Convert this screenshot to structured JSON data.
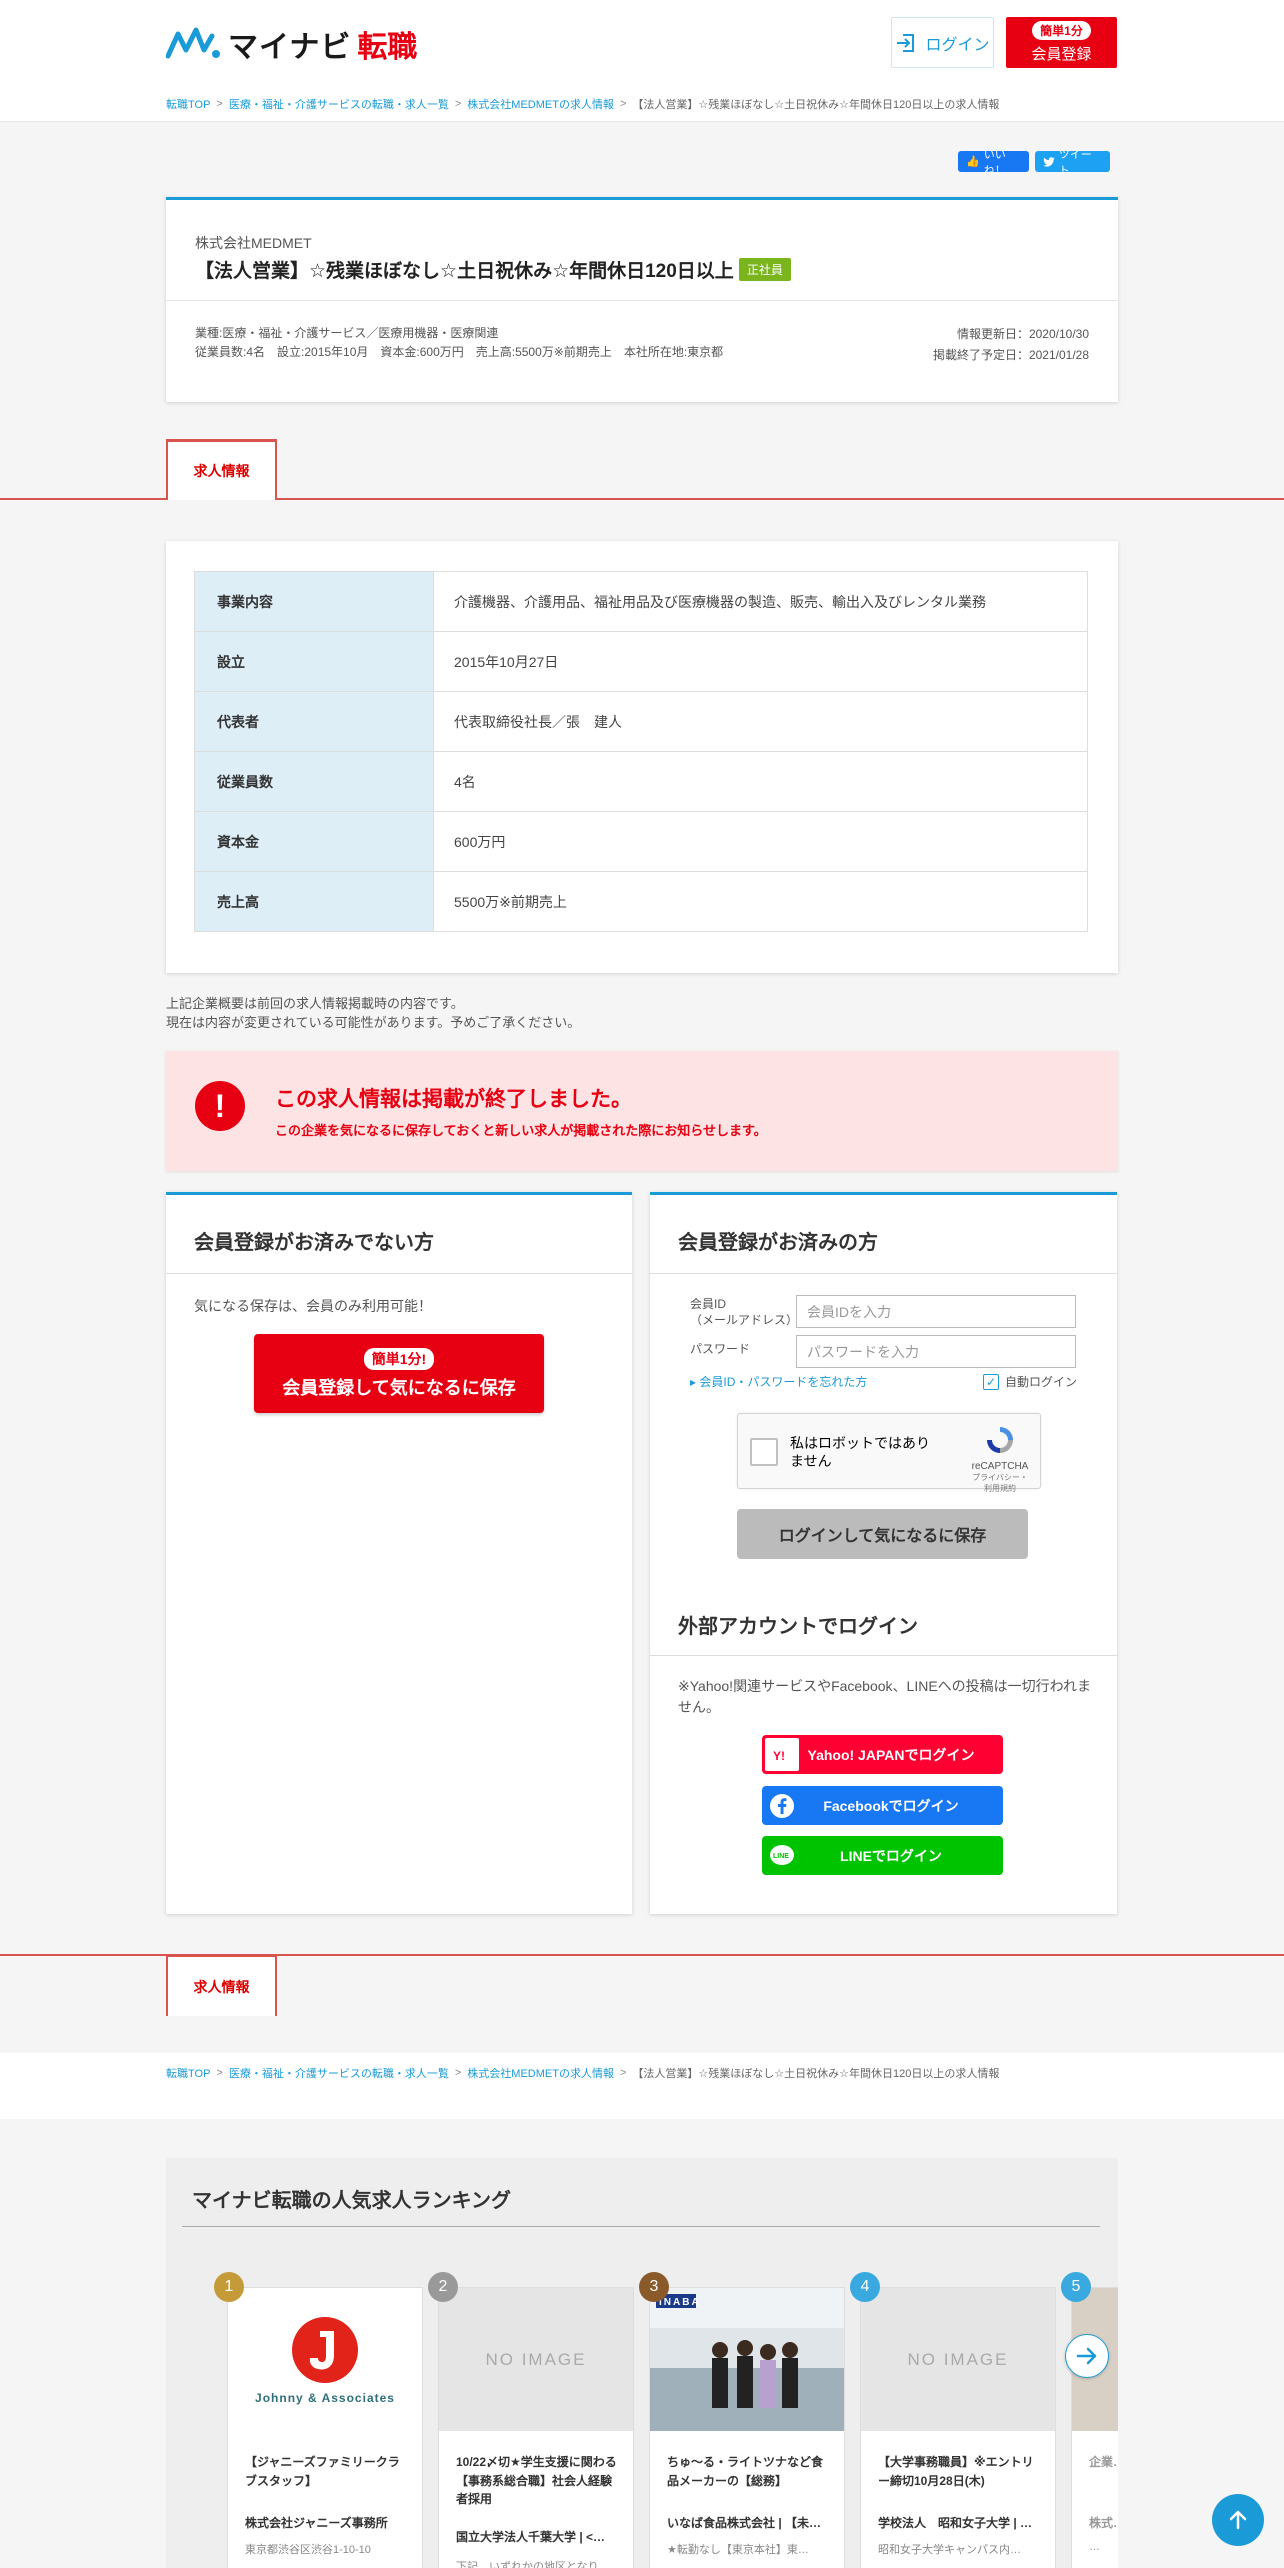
{
  "header": {
    "logo_main": "マイナビ",
    "logo_sub": "転職",
    "login_label": "ログイン",
    "register_pill": "簡単1分",
    "register_label": "会員登録"
  },
  "breadcrumb_top": [
    "転職TOP",
    "医療・福祉・介護サービスの転職・求人一覧",
    "株式会社MEDMETの求人情報",
    "【法人営業】☆残業ほぼなし☆土日祝休み☆年間休日120日以上の求人情報"
  ],
  "breadcrumb_bottom": [
    "転職TOP",
    "医療・福祉・介護サービスの転職・求人一覧",
    "株式会社MEDMETの求人情報",
    "【法人営業】☆残業ほぼなし☆土日祝休み☆年間休日120日以上の求人情報"
  ],
  "social": {
    "like": "いいね！",
    "tweet": "ツイート"
  },
  "job": {
    "company": "株式会社MEDMET",
    "title": "【法人営業】☆残業ほぼなし☆土日祝休み☆年間休日120日以上",
    "employment_type": "正社員",
    "industry": "業種:医療・福祉・介護サービス／医療用機器・医療関連",
    "summary": "従業員数:4名　設立:2015年10月　資本金:600万円　売上高:5500万※前期売上　本社所在地:東京都",
    "updated": "情報更新日：2020/10/30",
    "end_date": "掲載終了予定日：2021/01/28"
  },
  "tabs": {
    "job_info": "求人情報"
  },
  "company_info": [
    {
      "label": "事業内容",
      "value": "介護機器、介護用品、福祉用品及び医療機器の製造、販売、輸出入及びレンタル業務"
    },
    {
      "label": "設立",
      "value": "2015年10月27日"
    },
    {
      "label": "代表者",
      "value": "代表取締役社長／張　建人"
    },
    {
      "label": "従業員数",
      "value": "4名"
    },
    {
      "label": "資本金",
      "value": "600万円"
    },
    {
      "label": "売上高",
      "value": "5500万※前期売上"
    }
  ],
  "notice": {
    "line1": "上記企業概要は前回の求人情報掲載時の内容です。",
    "line2": "現在は内容が変更されている可能性があります。予めご了承ください。"
  },
  "ended": {
    "icon": "!",
    "title": "この求人情報は掲載が終了しました。",
    "subtitle": "この企業を気になるに保存しておくと新しい求人が掲載された際にお知らせします。"
  },
  "non_member": {
    "title": "会員登録がお済みでない方",
    "note": "気になる保存は、会員のみ利用可能！",
    "button_pill": "簡単1分!",
    "button_label": "会員登録して気になるに保存"
  },
  "member": {
    "title": "会員登録がお済みの方",
    "id_label_1": "会員ID",
    "id_label_2": "（メールアドレス）",
    "id_placeholder": "会員IDを入力",
    "password_label": "パスワード",
    "password_placeholder": "パスワードを入力",
    "forgot": "▸ 会員ID・パスワードを忘れた方",
    "auto_login": "自動ログイン",
    "recaptcha_label": "私はロボットではありません",
    "recaptcha_name": "reCAPTCHA",
    "recaptcha_privacy": "プライバシー・利用規約",
    "login_button": "ログインして気になるに保存",
    "ext_title": "外部アカウントでログイン",
    "ext_note": "※Yahoo!関連サービスやFacebook、LINEへの投稿は一切行われません。",
    "yahoo": "Yahoo! JAPANでログイン",
    "facebook": "Facebookでログイン",
    "line": "LINEでログイン"
  },
  "ranking": {
    "title": "マイナビ転職の人気求人ランキング",
    "no_image": "NO IMAGE",
    "items": [
      {
        "rank": "1",
        "catch": "【ジャニーズファミリークラブスタッフ】",
        "company": "株式会社ジャニーズ事務所",
        "address": "東京都渋谷区渋谷1-10-10",
        "logo_text": "Johnny & Associates"
      },
      {
        "rank": "2",
        "catch": "10/22〆切★学生支援に関わる【事務系総合職】社会人経験者採用",
        "company": "国立大学法人千葉大学 | <…",
        "address": "下記　いずれかの地区となり…"
      },
      {
        "rank": "3",
        "catch": "ちゅ～る・ライトツナなど食品メーカーの【総務】",
        "company": "いなば食品株式会社 | 【未経験…",
        "address": "★転勤なし【東京本社】東…",
        "logo_text": "INABA"
      },
      {
        "rank": "4",
        "catch": "【大学事務職員】※エントリー締切10月28日(木)",
        "company": "学校法人　昭和女子大学 | …",
        "address": "昭和女子大学キャンパス内…"
      },
      {
        "rank": "5",
        "catch": "企業…第二…",
        "company": "株式…",
        "address": "…"
      }
    ]
  },
  "colors": {
    "accent": "#1a9bd7",
    "brand_red": "#e60012",
    "tab_red": "#d9534f"
  }
}
